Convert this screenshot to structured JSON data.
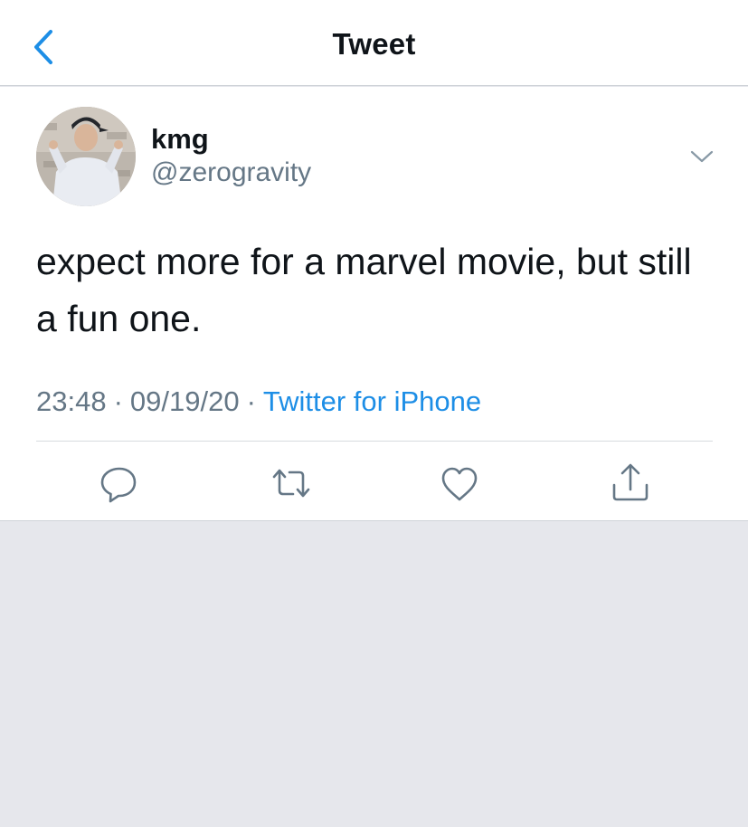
{
  "header": {
    "title": "Tweet",
    "back_icon": "chevron-left-icon"
  },
  "tweet": {
    "display_name": "kmg",
    "handle": "@zerogravity",
    "text": "expect more for a marvel movie, but still a fun one.",
    "time": "23:48",
    "date": "09/19/20",
    "separator": "·",
    "source": "Twitter for iPhone"
  },
  "actions": [
    "reply-icon",
    "retweet-icon",
    "like-icon",
    "share-icon"
  ],
  "colors": {
    "accent": "#1d8ee6",
    "text": "#0f1419",
    "secondary_text": "#657786",
    "icon": "#657786",
    "background": "#e6e7ec"
  }
}
